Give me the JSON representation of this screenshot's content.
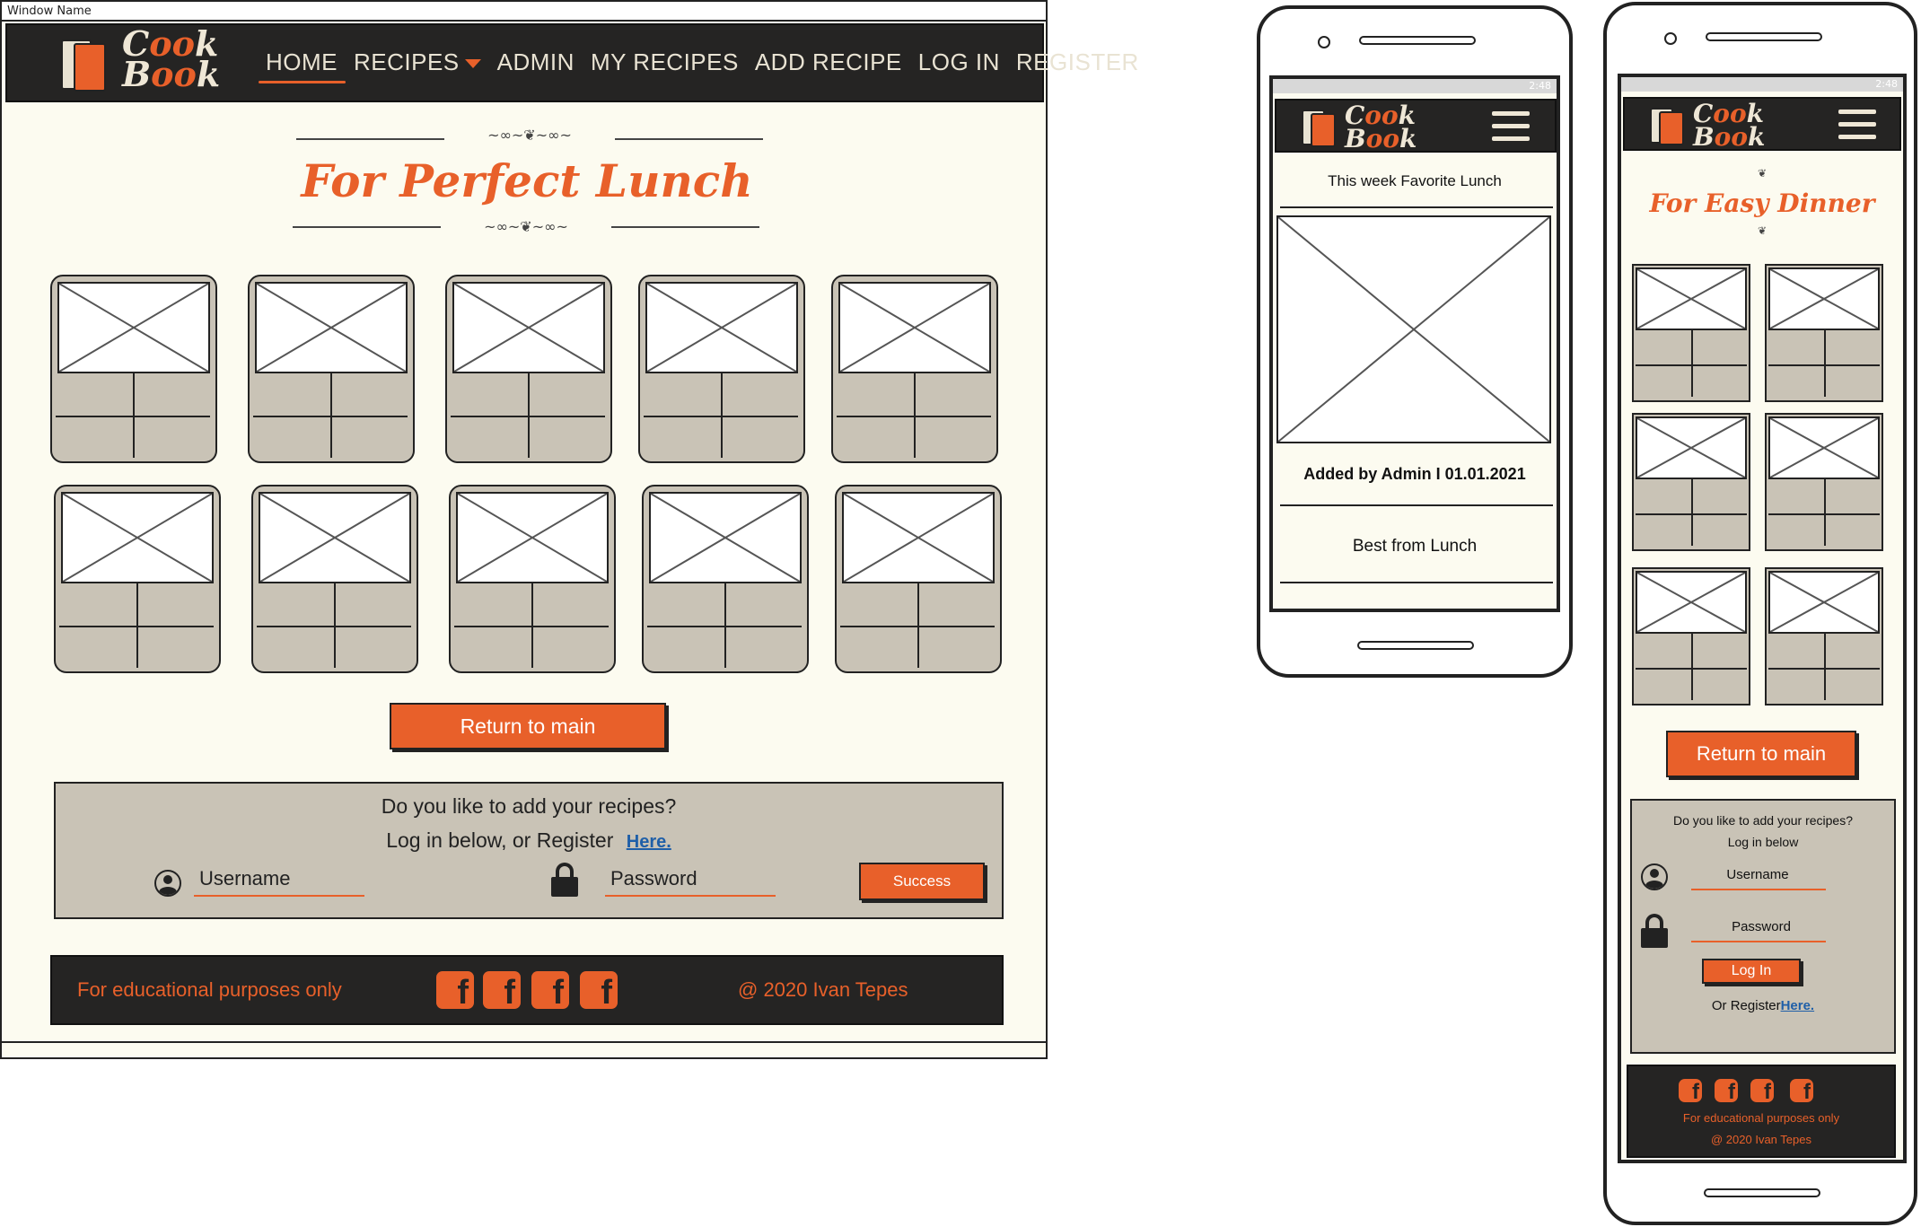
{
  "window": {
    "title": "Window Name"
  },
  "brand": {
    "word1": "Cook",
    "word2": "Book"
  },
  "nav": {
    "items": [
      "HOME",
      "RECIPES",
      "ADMIN",
      "MY RECIPES",
      "ADD RECIPE",
      "LOG IN",
      "REGISTER"
    ],
    "active": "HOME"
  },
  "desktop": {
    "title": "For Perfect Lunch",
    "return_button": "Return to main",
    "login": {
      "question": "Do you like to add your recipes?",
      "prompt": "Log in below, or Register",
      "register_link": "Here.",
      "username_placeholder": "Username",
      "password_placeholder": "Password",
      "submit": "Success"
    },
    "footer": {
      "left": "For educational purposes only",
      "right": "@ 2020 Ivan Tepes",
      "social_icons": [
        "facebook-icon",
        "facebook-icon",
        "facebook-icon",
        "facebook-icon"
      ]
    }
  },
  "phone1": {
    "status_time": "2:48",
    "heading": "This week Favorite Lunch",
    "meta": "Added by Admin I 01.01.2021",
    "sub": "Best from Lunch"
  },
  "phone2": {
    "status_time": "2:48",
    "title": "For Easy Dinner",
    "return_button": "Return to main",
    "login": {
      "question": "Do you like to add your recipes?",
      "prompt": "Log in below",
      "username": "Username",
      "password": "Password",
      "submit": "Log In",
      "or_register": "Or Register",
      "register_link": "Here."
    },
    "footer": {
      "line1": "For educational purposes only",
      "line2": "@ 2020 Ivan Tepes"
    }
  },
  "colors": {
    "accent": "#e8602a",
    "dark": "#252423",
    "card": "#c9c3b6",
    "page": "#fcfbf0",
    "link": "#1f5fa8"
  }
}
